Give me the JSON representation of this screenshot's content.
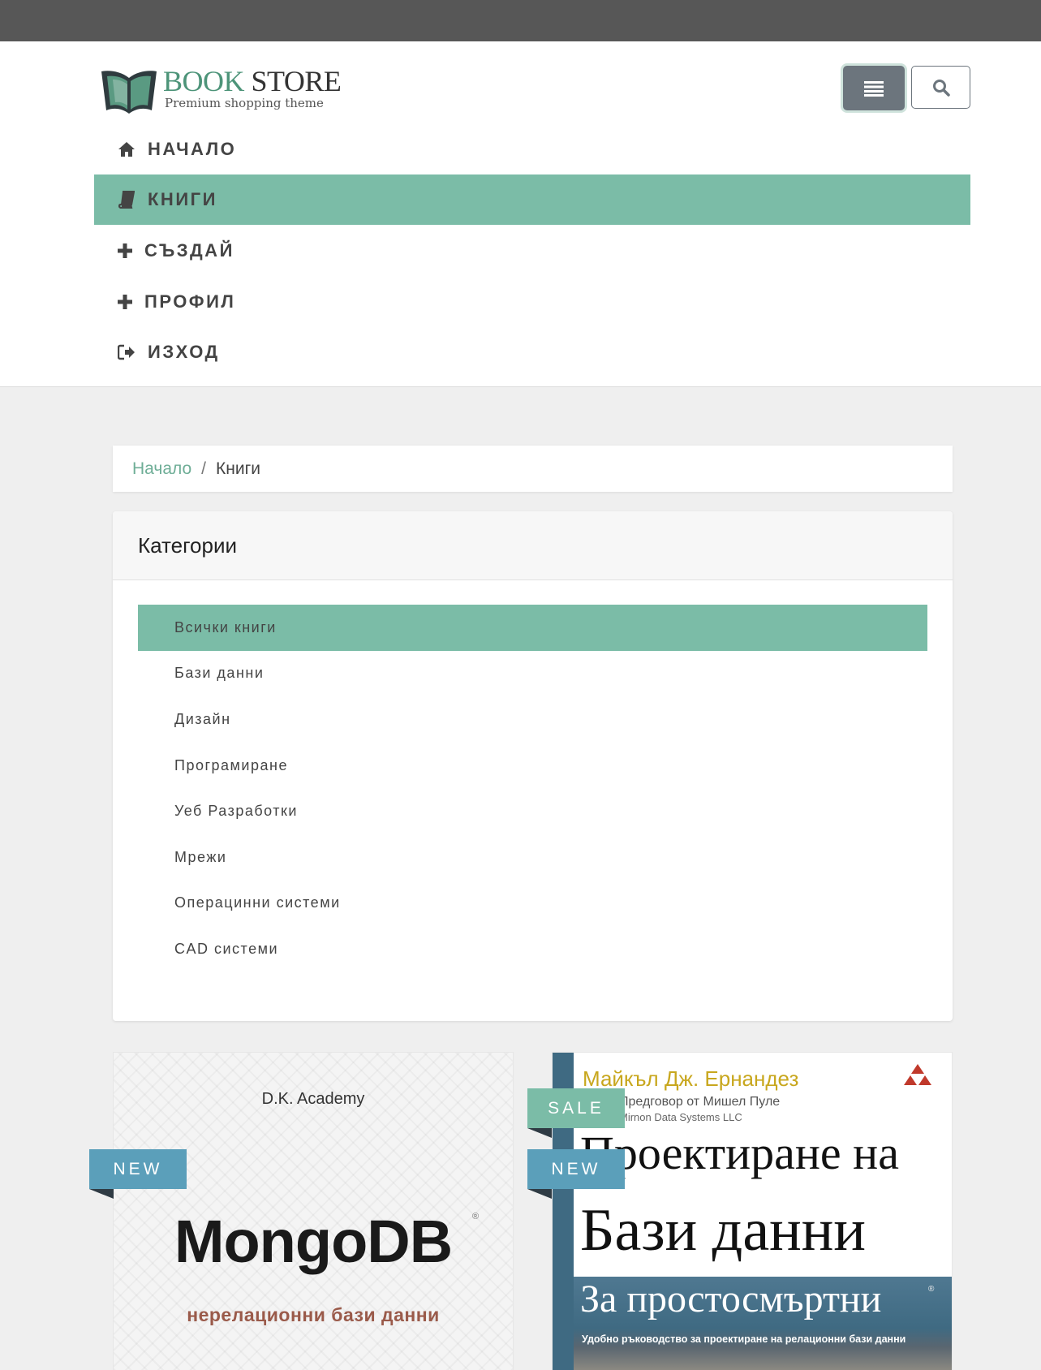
{
  "brand": {
    "name_part1": "BOOK",
    "name_part2": "STORE",
    "tagline": "Premium shopping theme"
  },
  "header_buttons": {
    "menu_icon": "menu-icon",
    "search_icon": "search-icon"
  },
  "nav": {
    "items": [
      {
        "label": "НАЧАЛО",
        "icon": "home-icon"
      },
      {
        "label": "КНИГИ",
        "icon": "book-icon",
        "active": true
      },
      {
        "label": "СЪЗДАЙ",
        "icon": "plus-icon"
      },
      {
        "label": "ПРОФИЛ",
        "icon": "plus-icon"
      },
      {
        "label": "ИЗХОД",
        "icon": "sign-out-icon"
      }
    ]
  },
  "breadcrumb": {
    "home": "Начало",
    "separator": "/",
    "current": "Книги"
  },
  "categories": {
    "title": "Категории",
    "items": [
      {
        "label": "Всички книги",
        "active": true
      },
      {
        "label": "Бази данни"
      },
      {
        "label": "Дизайн"
      },
      {
        "label": "Програмиране"
      },
      {
        "label": "Уеб Разработки"
      },
      {
        "label": "Мрежи"
      },
      {
        "label": "Операцинни системи"
      },
      {
        "label": "CAD системи"
      }
    ]
  },
  "books": [
    {
      "badges": [
        "NEW"
      ],
      "cover": {
        "author": "D.K. Academy",
        "title": "MongoDB",
        "registered": "®",
        "subtitle": "нерелационни бази данни"
      }
    },
    {
      "badges": [
        "SALE",
        "NEW"
      ],
      "cover": {
        "author": "Майкъл Дж. Ернандез",
        "line2": "Предговор от Мишел Пуле",
        "line3": "Mirnon Data Systems LLC",
        "title_line1": "Проектиране на",
        "title_line2": "Бази данни",
        "subtitle": "За простосмъртни",
        "registered": "®",
        "description": "Удобно ръководство за проектиране на релационни бази данни"
      }
    }
  ],
  "colors": {
    "accent": "#7bbca7",
    "new_badge": "#5b9fba",
    "topbar": "#575757",
    "menu_button": "#6c757d"
  }
}
